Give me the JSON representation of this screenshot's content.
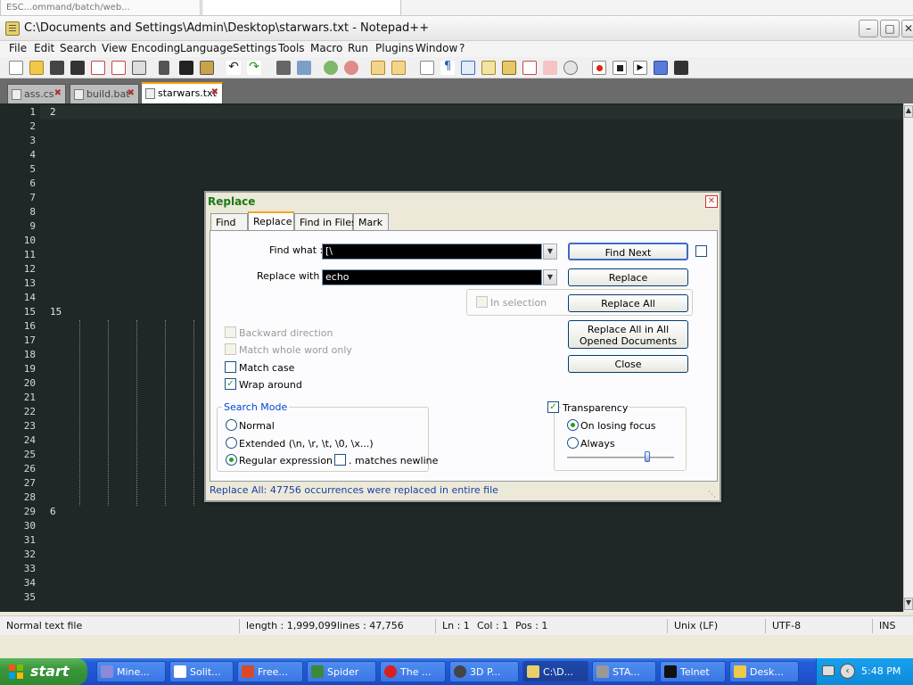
{
  "browser_strip": {
    "tab1": "ESC...ommand/batch/web..."
  },
  "window": {
    "title": "C:\\Documents and Settings\\Admin\\Desktop\\starwars.txt - Notepad++"
  },
  "menu": [
    "File",
    "Edit",
    "Search",
    "View",
    "Encoding",
    "Language",
    "Settings",
    "Tools",
    "Macro",
    "Run",
    "Plugins",
    "Window",
    "?"
  ],
  "tabs": [
    {
      "label": "ass.cs"
    },
    {
      "label": "build.bat"
    },
    {
      "label": "starwars.txt",
      "active": true
    }
  ],
  "editor": {
    "line_numbers": [
      "1",
      "2",
      "3",
      "4",
      "5",
      "6",
      "7",
      "8",
      "9",
      "10",
      "11",
      "12",
      "13",
      "14",
      "15",
      "16",
      "17",
      "18",
      "19",
      "20",
      "21",
      "22",
      "23",
      "24",
      "25",
      "26",
      "27",
      "28",
      "29",
      "30",
      "31",
      "32",
      "33",
      "34",
      "35"
    ],
    "visible_text": {
      "line1": "2",
      "line15": "15",
      "line29": "6"
    },
    "background": "#1f2826"
  },
  "statusbar": {
    "file_type": "Normal text file",
    "length": "length : 1,999,099",
    "lines": "lines : 47,756",
    "ln": "Ln : 1",
    "col": "Col : 1",
    "pos": "Pos : 1",
    "eol": "Unix (LF)",
    "encoding": "UTF-8",
    "mode": "INS"
  },
  "dialog": {
    "title": "Replace",
    "tabs": [
      "Find",
      "Replace",
      "Find in Files",
      "Mark"
    ],
    "active_tab": "Replace",
    "find_what_label": "Find what :",
    "find_what_value": "[\\",
    "replace_with_label": "Replace with :",
    "replace_with_value": "echo",
    "buttons": {
      "find_next": "Find Next",
      "replace": "Replace",
      "replace_all": "Replace All",
      "replace_all_opened": "Replace All in All Opened Documents",
      "close": "Close"
    },
    "in_selection": "In selection",
    "options": {
      "backward": "Backward direction",
      "whole_word": "Match whole word only",
      "match_case": "Match case",
      "wrap_around": "Wrap around"
    },
    "search_mode": {
      "title": "Search Mode",
      "normal": "Normal",
      "extended": "Extended (\\n, \\r, \\t, \\0, \\x...)",
      "regex": "Regular expression",
      "matches_newline": ". matches newline",
      "selected": "Regular expression"
    },
    "transparency": {
      "title": "Transparency",
      "on_losing_focus": "On losing focus",
      "always": "Always",
      "checked": true,
      "level": 0.75
    },
    "status": "Replace All: 47756 occurrences were replaced in entire file"
  },
  "taskbar": {
    "start": "start",
    "buttons": [
      "Mine...",
      "Solit...",
      "Free...",
      "Spider",
      "The ...",
      "3D P...",
      "C:\\D...",
      "STA...",
      "Telnet",
      "Desk..."
    ],
    "clock": "5:48 PM"
  },
  "colors": {
    "accent_tab": "#f2a20c",
    "dialog_title": "#1a7a1a",
    "taskbar": "#245edb",
    "start": "#3a963a"
  }
}
